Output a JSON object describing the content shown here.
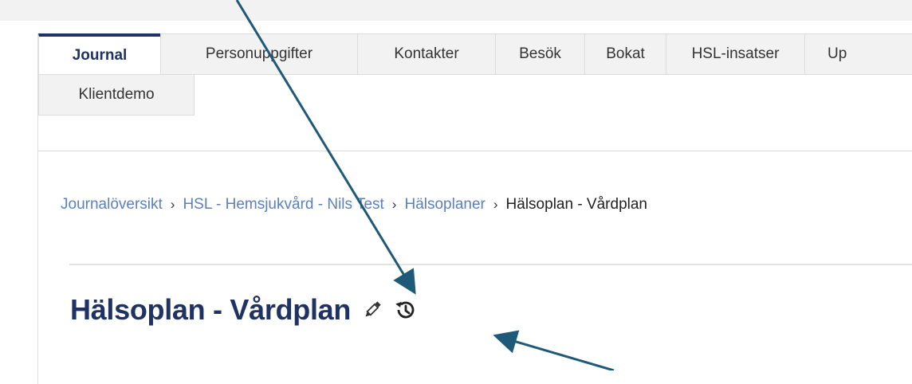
{
  "tabs": [
    {
      "label": "Journal",
      "active": true
    },
    {
      "label": "Personuppgifter",
      "active": false
    },
    {
      "label": "Kontakter",
      "active": false
    },
    {
      "label": "Besök",
      "active": false
    },
    {
      "label": "Bokat",
      "active": false
    },
    {
      "label": "HSL-insatser",
      "active": false
    },
    {
      "label": "Up",
      "active": false
    },
    {
      "label": "Klientdemo",
      "active": false
    }
  ],
  "breadcrumb": {
    "items": [
      "Journalöversikt",
      "HSL - Hemsjukvård - Nils Test",
      "Hälsoplaner"
    ],
    "current": "Hälsoplan - Vårdplan",
    "separator": "›"
  },
  "page": {
    "title": "Hälsoplan - Vårdplan"
  },
  "icons": {
    "edit": "pencil-icon",
    "history": "history-icon"
  },
  "colors": {
    "primary": "#1f3262",
    "link": "#5b7fc0",
    "annotation_arrow": "#1e5a78",
    "tab_background": "#f2f2f2"
  }
}
